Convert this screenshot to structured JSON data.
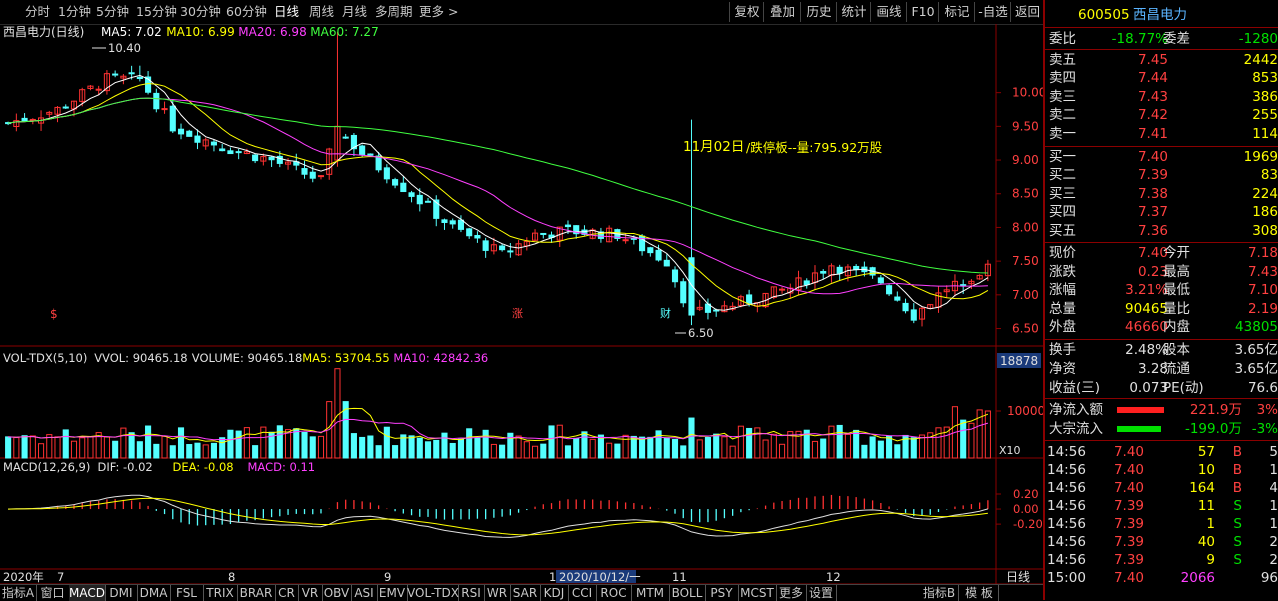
{
  "period_tabs": [
    "分时",
    "1分钟",
    "5分钟",
    "15分钟",
    "30分钟",
    "60分钟",
    "日线",
    "周线",
    "月线",
    "多周期",
    "更多 >"
  ],
  "active_tab": "日线",
  "toolbar_buttons": [
    "复权",
    "叠加",
    "历史",
    "统计",
    "画线",
    "F10",
    "标记",
    "-自选",
    "返回"
  ],
  "stock": {
    "code": "600505",
    "name": "西昌电力"
  },
  "main_panel": {
    "title": "西昌电力(日线)",
    "ma_labels": [
      {
        "text": "MA5: 7.02",
        "color": "#ffffff"
      },
      {
        "text": "MA10: 6.99",
        "color": "#ffff00"
      },
      {
        "text": "MA20: 6.98",
        "color": "#ff40ff"
      },
      {
        "text": "MA60: 7.27",
        "color": "#40ff40"
      }
    ],
    "annotation_date": "11月02日",
    "annotation_text": "/跌停板--量:795.92万股",
    "high_marker": "10.40",
    "low_marker": "6.50",
    "event_markers": [
      "$",
      "涨",
      "财"
    ]
  },
  "vol_panel": {
    "labels": [
      {
        "text": "VOL-TDX(5,10)",
        "color": "#e0e0e0"
      },
      {
        "text": "VVOL: 90465.18",
        "color": "#e0e0e0"
      },
      {
        "text": "VOLUME: 90465.18",
        "color": "#e0e0e0"
      },
      {
        "text": "MA5: 53704.55",
        "color": "#ffff00"
      },
      {
        "text": "MA10: 42842.36",
        "color": "#ff40ff"
      }
    ],
    "axis_value": "18878",
    "axis_tick": "10000",
    "scale_label": "X10"
  },
  "macd_panel": {
    "labels": [
      {
        "text": "MACD(12,26,9)",
        "color": "#e0e0e0"
      },
      {
        "text": "DIF: -0.02",
        "color": "#e0e0e0"
      },
      {
        "text": "DEA: -0.08",
        "color": "#ffff00"
      },
      {
        "text": "MACD: 0.11",
        "color": "#ff40ff"
      }
    ],
    "ticks": [
      "0.20",
      "0.00",
      "-0.20"
    ]
  },
  "x_axis": {
    "labels": [
      "2020年",
      "7",
      "8",
      "9",
      "1",
      "2020/10/12/一",
      "11",
      "12"
    ],
    "period_label": "日线"
  },
  "bottom_tabs": [
    "指标A",
    "窗口",
    "MACD",
    "DMI",
    "DMA",
    "FSL",
    "TRIX",
    "BRAR",
    "CR",
    "VR",
    "OBV",
    "ASI",
    "EMV",
    "VOL-TDX",
    "RSI",
    "WR",
    "SAR",
    "KDJ",
    "CCI",
    "ROC",
    "MTM",
    "BOLL",
    "PSY",
    "MCST",
    "更多",
    "设置"
  ],
  "bottom_right_tabs": [
    "指标B",
    "模 板"
  ],
  "colors": {
    "up": "#ff3232",
    "down": "#54ffff",
    "ma5": "#ffffff",
    "ma10": "#ffff00",
    "ma20": "#ff40ff",
    "ma60": "#40ff40",
    "grid": "#8b0000"
  },
  "quote": {
    "weibi": {
      "label": "委比",
      "value": "-18.77%",
      "label2": "委差",
      "value2": "-1280"
    },
    "sell": [
      {
        "label": "卖五",
        "price": "7.45",
        "vol": "2442"
      },
      {
        "label": "卖四",
        "price": "7.44",
        "vol": "853"
      },
      {
        "label": "卖三",
        "price": "7.43",
        "vol": "386"
      },
      {
        "label": "卖二",
        "price": "7.42",
        "vol": "255"
      },
      {
        "label": "卖一",
        "price": "7.41",
        "vol": "114"
      }
    ],
    "buy": [
      {
        "label": "买一",
        "price": "7.40",
        "vol": "1969"
      },
      {
        "label": "买二",
        "price": "7.39",
        "vol": "83"
      },
      {
        "label": "买三",
        "price": "7.38",
        "vol": "224"
      },
      {
        "label": "买四",
        "price": "7.37",
        "vol": "186"
      },
      {
        "label": "买五",
        "price": "7.36",
        "vol": "308"
      }
    ],
    "stats": [
      {
        "l1": "现价",
        "v1": "7.40",
        "l2": "今开",
        "v2": "7.18"
      },
      {
        "l1": "涨跌",
        "v1": "0.23",
        "l2": "最高",
        "v2": "7.43"
      },
      {
        "l1": "涨幅",
        "v1": "3.21%",
        "l2": "最低",
        "v2": "7.10"
      },
      {
        "l1": "总量",
        "v1": "90465",
        "l2": "量比",
        "v2": "2.19"
      },
      {
        "l1": "外盘",
        "v1": "46660",
        "l2": "内盘",
        "v2": "43805"
      }
    ],
    "stats2": [
      {
        "l1": "换手",
        "v1": "2.48%",
        "l2": "股本",
        "v2": "3.65亿"
      },
      {
        "l1": "净资",
        "v1": "3.28",
        "l2": "流通",
        "v2": "3.65亿"
      },
      {
        "l1": "收益(三)",
        "v1": "0.073",
        "l2": "PE(动)",
        "v2": "76.6"
      }
    ],
    "flows": [
      {
        "label": "净流入额",
        "value": "221.9万",
        "pct": "3%",
        "fraction": 0.85
      },
      {
        "label": "大宗流入",
        "value": "-199.0万",
        "pct": "-3%",
        "fraction": 0.8
      }
    ],
    "ticks": [
      {
        "time": "14:56",
        "price": "7.40",
        "vol": "57",
        "side": "B",
        "num": "5"
      },
      {
        "time": "14:56",
        "price": "7.40",
        "vol": "10",
        "side": "B",
        "num": "1"
      },
      {
        "time": "14:56",
        "price": "7.40",
        "vol": "164",
        "side": "B",
        "num": "4"
      },
      {
        "time": "14:56",
        "price": "7.39",
        "vol": "11",
        "side": "S",
        "num": "1"
      },
      {
        "time": "14:56",
        "price": "7.39",
        "vol": "1",
        "side": "S",
        "num": "1"
      },
      {
        "time": "14:56",
        "price": "7.39",
        "vol": "40",
        "side": "S",
        "num": "2"
      },
      {
        "time": "14:56",
        "price": "7.39",
        "vol": "9",
        "side": "S",
        "num": "2"
      },
      {
        "time": "15:00",
        "price": "7.40",
        "vol": "2066",
        "side": "",
        "num": "96"
      }
    ]
  },
  "chart_data": {
    "type": "candlestick",
    "title": "西昌电力(日线)",
    "price_axis": {
      "ticks": [
        6.5,
        7.0,
        7.5,
        8.0,
        8.5,
        9.0,
        9.5,
        10.0
      ],
      "range": [
        6.3,
        10.9
      ]
    },
    "candle_count": 120,
    "approx_close_path": [
      {
        "i": 0,
        "close": 9.55
      },
      {
        "i": 6,
        "close": 9.75
      },
      {
        "i": 12,
        "close": 10.2
      },
      {
        "i": 16,
        "close": 10.2
      },
      {
        "i": 20,
        "close": 9.5
      },
      {
        "i": 26,
        "close": 9.2
      },
      {
        "i": 32,
        "close": 9.0
      },
      {
        "i": 38,
        "close": 8.7
      },
      {
        "i": 40,
        "close": 9.45
      },
      {
        "i": 43,
        "close": 9.1
      },
      {
        "i": 48,
        "close": 8.6
      },
      {
        "i": 54,
        "close": 8.0
      },
      {
        "i": 60,
        "close": 7.6
      },
      {
        "i": 64,
        "close": 7.9
      },
      {
        "i": 68,
        "close": 7.95
      },
      {
        "i": 74,
        "close": 7.9
      },
      {
        "i": 80,
        "close": 7.5
      },
      {
        "i": 83,
        "close": 6.7
      },
      {
        "i": 88,
        "close": 6.85
      },
      {
        "i": 95,
        "close": 7.1
      },
      {
        "i": 100,
        "close": 7.45
      },
      {
        "i": 106,
        "close": 7.2
      },
      {
        "i": 110,
        "close": 6.7
      },
      {
        "i": 114,
        "close": 7.1
      },
      {
        "i": 119,
        "close": 7.4
      }
    ],
    "notable": [
      {
        "label": "10.40",
        "type": "high"
      },
      {
        "label": "6.50",
        "type": "low"
      },
      {
        "label": "11月02日",
        "type": "limit-down",
        "volume": "795.92万股"
      }
    ],
    "last": {
      "ma5": 7.02,
      "ma10": 6.99,
      "ma20": 6.98,
      "ma60": 7.27,
      "volume": 90465.18,
      "vol_ma5": 53704.55,
      "vol_ma10": 42842.36,
      "dif": -0.02,
      "dea": -0.08,
      "macd": 0.11
    }
  }
}
